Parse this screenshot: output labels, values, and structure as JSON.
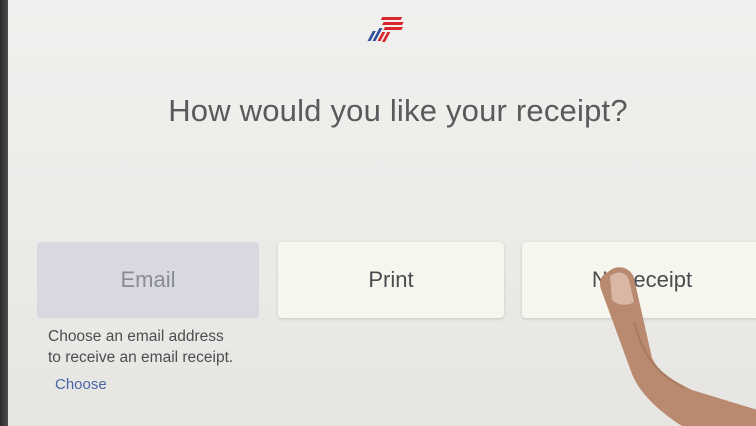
{
  "logo": {
    "icon": "bank-flag-logo-icon",
    "colors": [
      "#2f4f9e",
      "#d8262c"
    ]
  },
  "prompt": {
    "headline": "How would you like your receipt?"
  },
  "options": {
    "email_label": "Email",
    "print_label": "Print",
    "no_receipt_label": "No receipt"
  },
  "email_help": {
    "line1": "Choose an email address",
    "line2": "to receive an email receipt.",
    "link": "Choose"
  },
  "colors": {
    "accent_link": "#4a66a8",
    "email_button_bg": "#d7d8e0",
    "button_bg": "#f6f5ee"
  }
}
